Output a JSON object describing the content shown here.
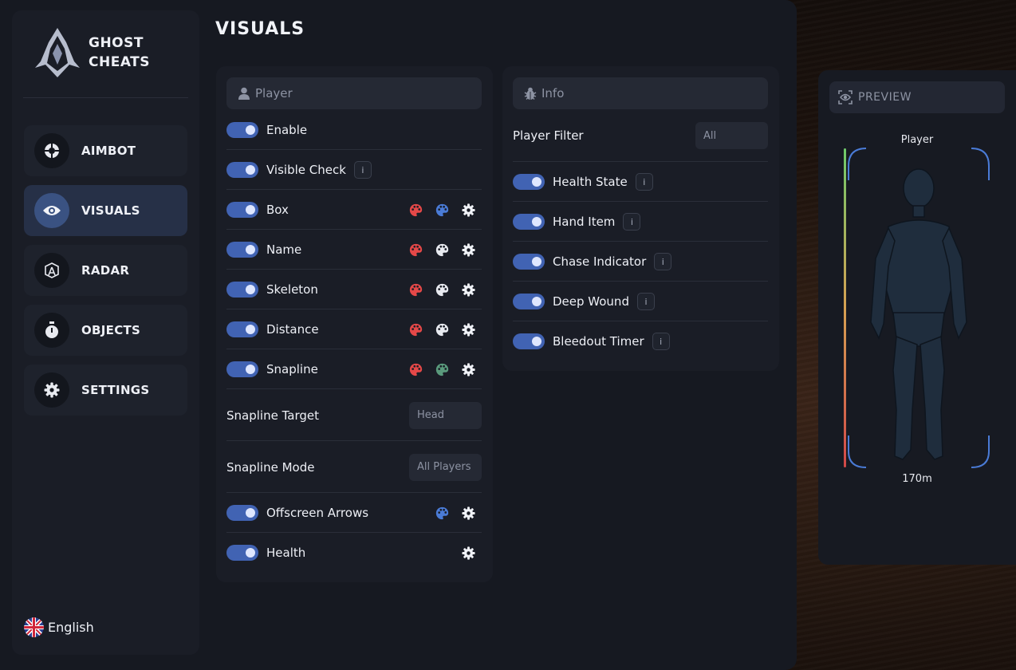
{
  "brand": {
    "line1": "GHOST",
    "line2": "CHEATS"
  },
  "nav": [
    {
      "label": "AIMBOT",
      "icon": "crosshair-icon"
    },
    {
      "label": "VISUALS",
      "icon": "eye-icon",
      "active": true
    },
    {
      "label": "RADAR",
      "icon": "radar-icon"
    },
    {
      "label": "OBJECTS",
      "icon": "stopwatch-icon"
    },
    {
      "label": "SETTINGS",
      "icon": "gear-icon"
    }
  ],
  "language": "English",
  "page_title": "VISUALS",
  "player_panel": {
    "header": "Player",
    "rows": [
      {
        "label": "Enable",
        "enabled": true
      },
      {
        "label": "Visible Check",
        "enabled": true,
        "info": "i"
      },
      {
        "label": "Box",
        "enabled": true
      },
      {
        "label": "Name",
        "enabled": true
      },
      {
        "label": "Skeleton",
        "enabled": true
      },
      {
        "label": "Distance",
        "enabled": true
      },
      {
        "label": "Snapline",
        "enabled": true
      }
    ],
    "snapline_target": {
      "label": "Snapline Target",
      "value": "Head"
    },
    "snapline_mode": {
      "label": "Snapline Mode",
      "value": "All Players"
    },
    "offscreen_arrows": {
      "label": "Offscreen Arrows",
      "enabled": true
    },
    "health": {
      "label": "Health",
      "enabled": true
    }
  },
  "info_panel": {
    "header": "Info",
    "player_filter": {
      "label": "Player Filter",
      "value": "All"
    },
    "rows": [
      {
        "label": "Health State",
        "enabled": true,
        "info": "i"
      },
      {
        "label": "Hand Item",
        "enabled": true,
        "info": "i"
      },
      {
        "label": "Chase Indicator",
        "enabled": true,
        "info": "i"
      },
      {
        "label": "Deep Wound",
        "enabled": true,
        "info": "i"
      },
      {
        "label": "Bleedout Timer",
        "enabled": true,
        "info": "i"
      }
    ]
  },
  "preview": {
    "header": "PREVIEW",
    "player_name": "Player",
    "distance": "170m"
  },
  "colors": {
    "accent": "#4163b3",
    "palette_red": "#e54848",
    "palette_blue": "#4a7bd6",
    "palette_white": "#e8eaf0",
    "palette_green": "#5a9a7c"
  }
}
